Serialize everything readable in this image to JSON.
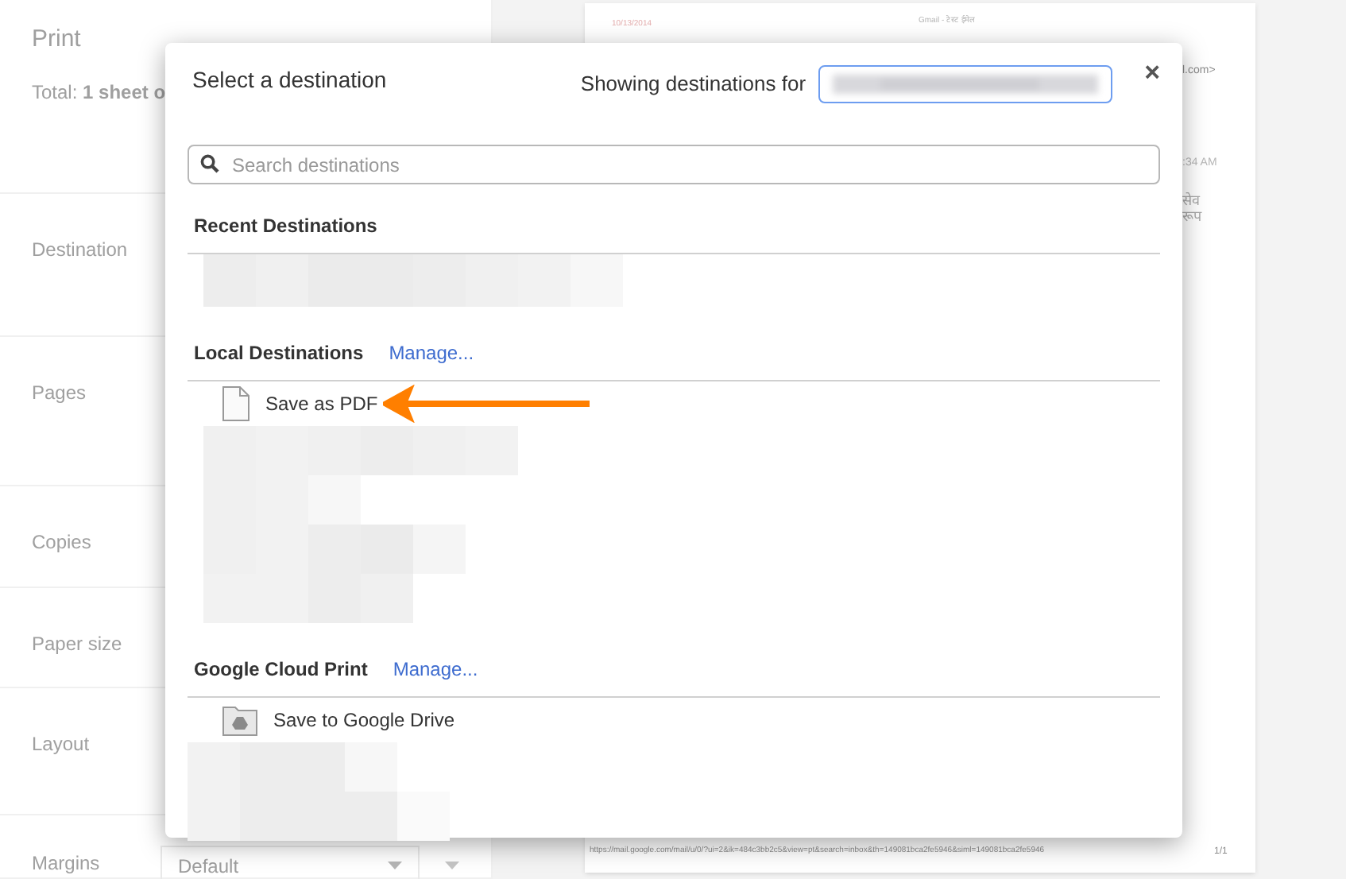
{
  "settings": {
    "title": "Print",
    "total": "Total: **1 sheet o**",
    "rows": [
      {
        "label": "Destination"
      },
      {
        "label": "Pages"
      },
      {
        "label": "Copies"
      },
      {
        "label": "Paper size"
      },
      {
        "label": "Layout"
      },
      {
        "label": "Margins",
        "value": "Default"
      }
    ]
  },
  "preview": {
    "date": "10/13/2014",
    "header": "Gmail - टेस्ट ईमेल",
    "fragments": [
      "l.com>",
      ":34 AM",
      "सेव",
      "रूप"
    ],
    "footer_url": "https://mail.google.com/mail/u/0/?ui=2&ik=484c3bb2c5&view=pt&search=inbox&th=149081bca2fe5946&siml=149081bca2fe5946",
    "page_number": "1/1"
  },
  "dialog": {
    "title": "Select a destination",
    "showing_label": "Showing destinations for",
    "close": "×",
    "search": {
      "placeholder": "Search destinations"
    },
    "sections": [
      {
        "title": "Recent Destinations",
        "items": [
          {
            "kind": "hidden"
          }
        ]
      },
      {
        "title": "Local Destinations",
        "link": "Manage...",
        "items": [
          {
            "kind": "pdf",
            "label": "Save as PDF",
            "highlighted": true
          },
          {
            "kind": "hidden"
          }
        ]
      },
      {
        "title": "Google Cloud Print",
        "link": "Manage...",
        "items": [
          {
            "kind": "drive",
            "label": "Save to Google Drive",
            "highlighted": false
          },
          {
            "kind": "hidden"
          }
        ]
      }
    ]
  }
}
